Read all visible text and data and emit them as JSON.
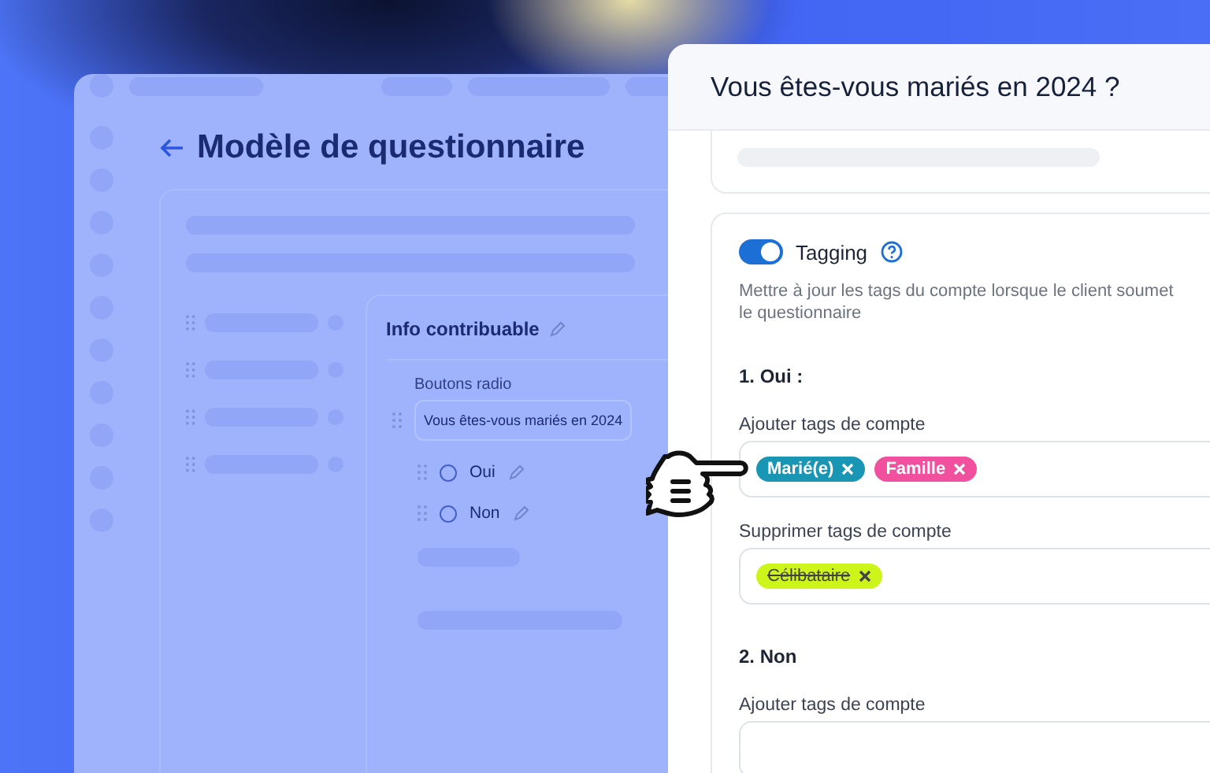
{
  "background_page": {
    "title": "Modèle de questionnaire",
    "section": {
      "title": "Info contribuable",
      "field_label": "Boutons radio",
      "question": "Vous êtes-vous mariés en 2024",
      "options": [
        {
          "label": "Oui",
          "selected": false
        },
        {
          "label": "Non",
          "selected": false
        }
      ]
    }
  },
  "panel": {
    "title": "Vous êtes-vous mariés en 2024 ?",
    "tagging": {
      "label": "Tagging",
      "on": true,
      "description": "Mettre à jour les tags du compte lorsque le client soumet le questionnaire"
    },
    "answers": [
      {
        "heading": "1. Oui :",
        "fields": [
          {
            "label": "Ajouter tags de compte",
            "tags": [
              {
                "label": "Marié(e)",
                "color": "#1a96b5",
                "struck": false
              },
              {
                "label": "Famille",
                "color": "#f0509e",
                "struck": false
              }
            ]
          },
          {
            "label": "Supprimer tags de compte",
            "tags": [
              {
                "label": "Célibataire",
                "color": "#cdf51a",
                "struck": true
              }
            ]
          }
        ]
      },
      {
        "heading": "2. Non",
        "fields": [
          {
            "label": "Ajouter tags de compte"
          }
        ]
      }
    ]
  }
}
